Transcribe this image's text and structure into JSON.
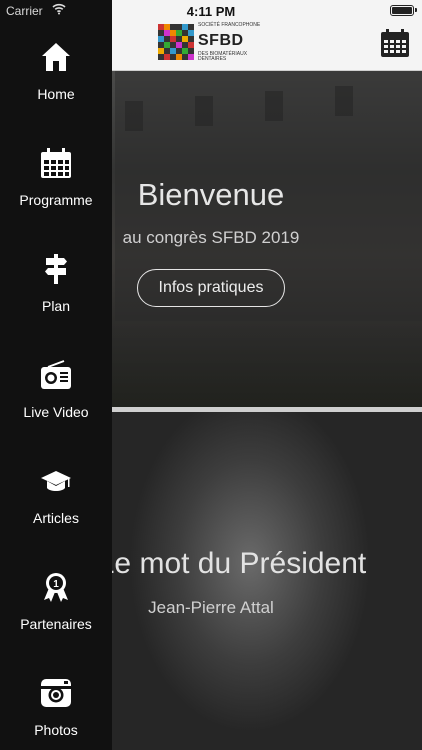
{
  "status": {
    "carrier": "Carrier",
    "time": "4:11 PM",
    "battery_level": 0.9
  },
  "navbar": {
    "logo_text": "SFBD",
    "logo_top_text": "SOCIÉTÉ FRANCOPHONE",
    "logo_bottom_text": "DES BIOMATÉRIAUX DENTAIRES",
    "calendar_icon": "calendar-icon"
  },
  "hero": {
    "title": "Bienvenue",
    "subtitle": "au congrès SFBD 2019",
    "button_label": "Infos pratiques"
  },
  "president": {
    "title": "Le mot du Président",
    "name": "Jean-Pierre Attal"
  },
  "menu": {
    "items": [
      {
        "label": "Home",
        "icon": "home-icon"
      },
      {
        "label": "Programme",
        "icon": "calendar-icon"
      },
      {
        "label": "Plan",
        "icon": "signpost-icon"
      },
      {
        "label": "Live Video",
        "icon": "radio-icon"
      },
      {
        "label": "Articles",
        "icon": "graduation-cap-icon"
      },
      {
        "label": "Partenaires",
        "icon": "award-icon"
      },
      {
        "label": "Photos",
        "icon": "camera-icon"
      }
    ]
  },
  "colors": {
    "drawer_bg": "#111111",
    "navbar_bg": "#f4f4f4",
    "text_light": "#ffffff"
  }
}
